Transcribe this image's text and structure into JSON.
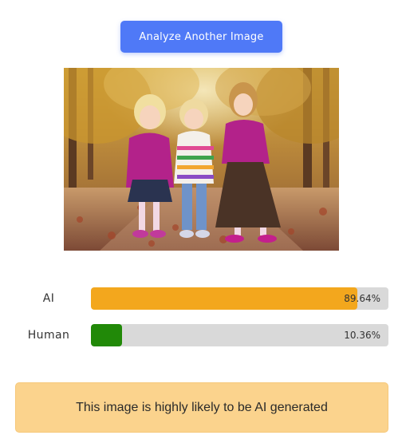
{
  "actions": {
    "analyze_label": "Analyze Another Image"
  },
  "image": {
    "alt": "Three young girls standing on an autumn leaf-covered path"
  },
  "results": [
    {
      "label": "AI",
      "value_text": "89.64%",
      "fraction": 0.8964,
      "color": "#f3a71d"
    },
    {
      "label": "Human",
      "value_text": "10.36%",
      "fraction": 0.1036,
      "color": "#218908"
    }
  ],
  "verdict": {
    "text": "This image is highly likely to be AI generated",
    "background": "#fbd38d"
  },
  "colors": {
    "button": "#4f79f7",
    "track": "#d9d9d9"
  }
}
